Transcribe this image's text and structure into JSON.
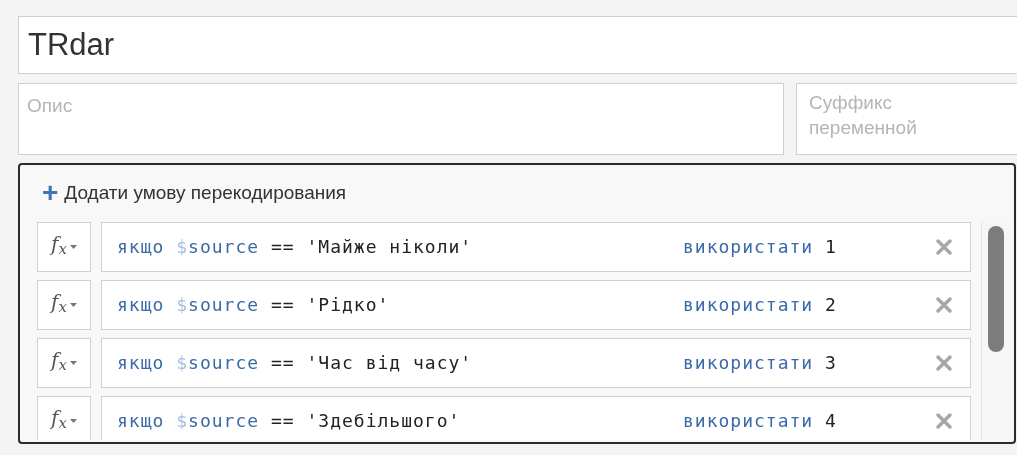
{
  "name_field": {
    "value": "TRdar"
  },
  "description_field": {
    "placeholder": "Опис"
  },
  "suffix_field": {
    "placeholder": "Суффикс переменной"
  },
  "recode_panel": {
    "add_button": {
      "icon": "+",
      "label": "Додати умову перекодирования"
    },
    "rules": [
      {
        "function_label": "f$_{x}$",
        "keyword": "якщо",
        "sigil": "$",
        "variable": "source",
        "operator": "==",
        "value": "'Майже ніколи'",
        "action": "використати",
        "result": "1"
      },
      {
        "function_label": "f$_{x}$",
        "keyword": "якщо",
        "sigil": "$",
        "variable": "source",
        "operator": "==",
        "value": "'Рідко'",
        "action": "використати",
        "result": "2"
      },
      {
        "function_label": "f$_{x}$",
        "keyword": "якщо",
        "sigil": "$",
        "variable": "source",
        "operator": "==",
        "value": "'Час від часу'",
        "action": "використати",
        "result": "3"
      },
      {
        "function_label": "f$_{x}$",
        "keyword": "якщо",
        "sigil": "$",
        "variable": "source",
        "operator": "==",
        "value": "'Здебільшого'",
        "action": "використати",
        "result": "4"
      }
    ]
  }
}
